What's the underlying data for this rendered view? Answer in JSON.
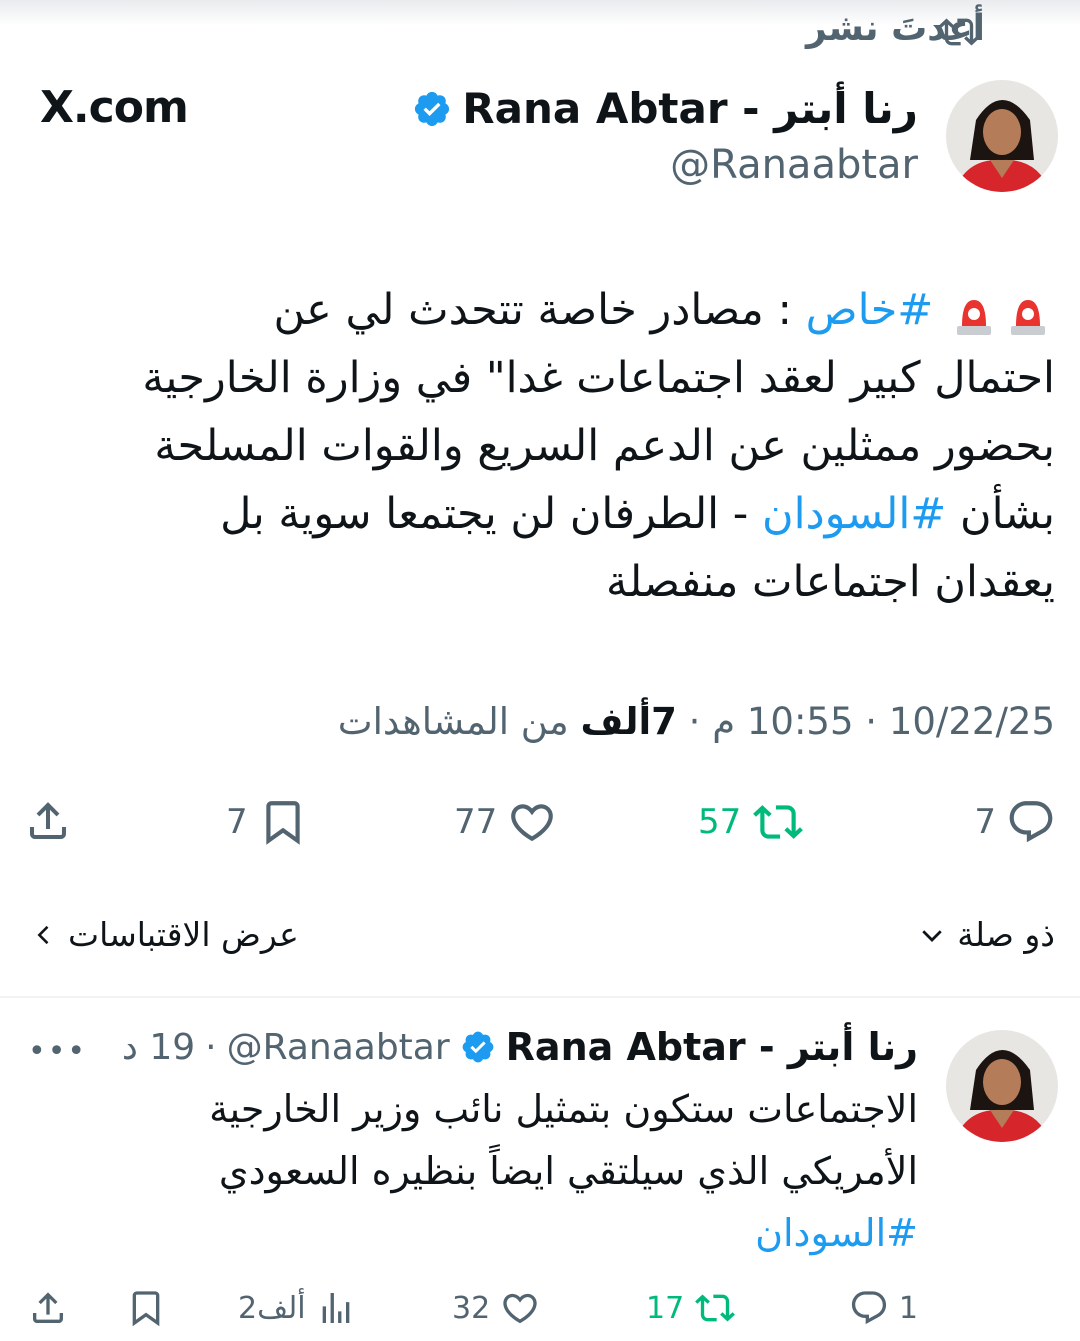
{
  "repost_indicator": {
    "label": "أعدتَ نشر",
    "icon": "repost-icon"
  },
  "source_label": "X.com",
  "tweet": {
    "author_name": "رنا أبتر - Rana Abtar",
    "handle": "@Ranaabtar",
    "verified": true,
    "line1_prefix_tag": "#خاص",
    "line1_text": ": مصادر خاصة تتحدث لي عن",
    "line2": "احتمال كبير لعقد اجتماعات غدا\" في وزارة الخارجية",
    "line3": "بحضور ممثلين عن الدعم السريع والقوات المسلحة",
    "line4_start": "بشأن",
    "line4_tag": "#السودان",
    "line4_end": "- الطرفان لن يجتمعا سوية بل",
    "line5": "يعقدان اجتماعات منفصلة",
    "date": "10/22/25",
    "time": "10:55 م",
    "views_count": "7ألف",
    "views_label": "من المشاهدات",
    "counts": {
      "replies": "7",
      "reposts": "57",
      "likes": "77",
      "bookmarks": "7"
    }
  },
  "links": {
    "related": "ذو صلة",
    "view_quotes": "عرض الاقتباسات"
  },
  "reply": {
    "author_name": "رنا أبتر - Rana Abtar",
    "handle": "@Ranaabtar",
    "age": "19 د",
    "line1": "الاجتماعات ستكون بتمثيل نائب وزير الخارجية",
    "line2": "الأمريكي الذي سيلتقي ايضاً بنظيره السعودي",
    "tag": "#السودان",
    "counts": {
      "replies": "1",
      "reposts": "17",
      "likes": "32",
      "views": "2ألف"
    }
  },
  "colors": {
    "accent": "#1d9bf0",
    "repost_green": "#00ba7c",
    "muted": "#536471",
    "avatar_dress": "#d7262b"
  }
}
